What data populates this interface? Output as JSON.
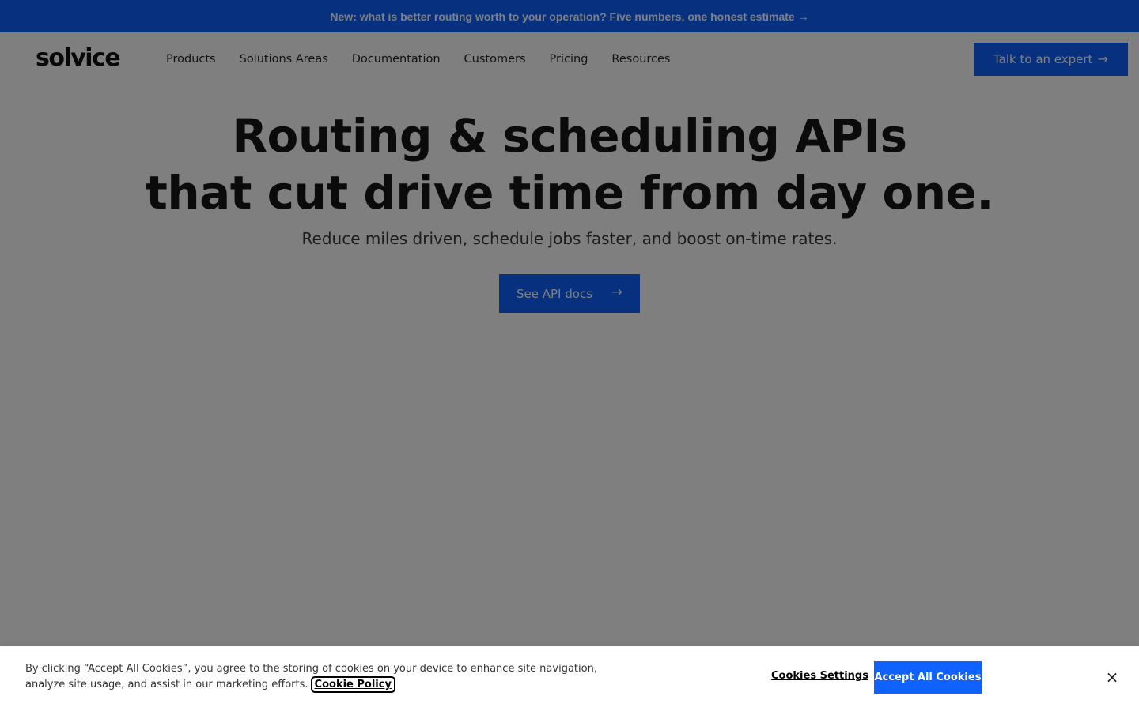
{
  "announcement": {
    "text": "New: what is better routing worth to your operation? Five numbers, one honest estimate →"
  },
  "header": {
    "logo": "solvice",
    "nav": [
      "Products",
      "Solutions Areas",
      "Documentation",
      "Customers",
      "Pricing",
      "Resources"
    ],
    "cta_label": "Talk to an expert",
    "cta_icon": "arrow-right-icon"
  },
  "hero": {
    "title_line1": "Routing & scheduling APIs",
    "title_line2": "that cut drive time from day one.",
    "subtitle": "Reduce miles driven, schedule jobs faster, and boost on-time rates.",
    "button_label": "See API docs",
    "button_icon": "arrow-right-icon"
  },
  "cookie_banner": {
    "text": "By clicking “Accept All Cookies”, you agree to the storing of cookies on your device to enhance site navigation, analyze site usage, and assist in our marketing efforts.",
    "policy_link": "Cookie Policy",
    "settings_button": "Cookies Settings",
    "accept_button": "Accept All Cookies",
    "close_icon": "close-icon"
  },
  "colors": {
    "accent": "#0f62fe",
    "overlay": "rgba(0,0,0,0.5)",
    "text": "#161616"
  }
}
